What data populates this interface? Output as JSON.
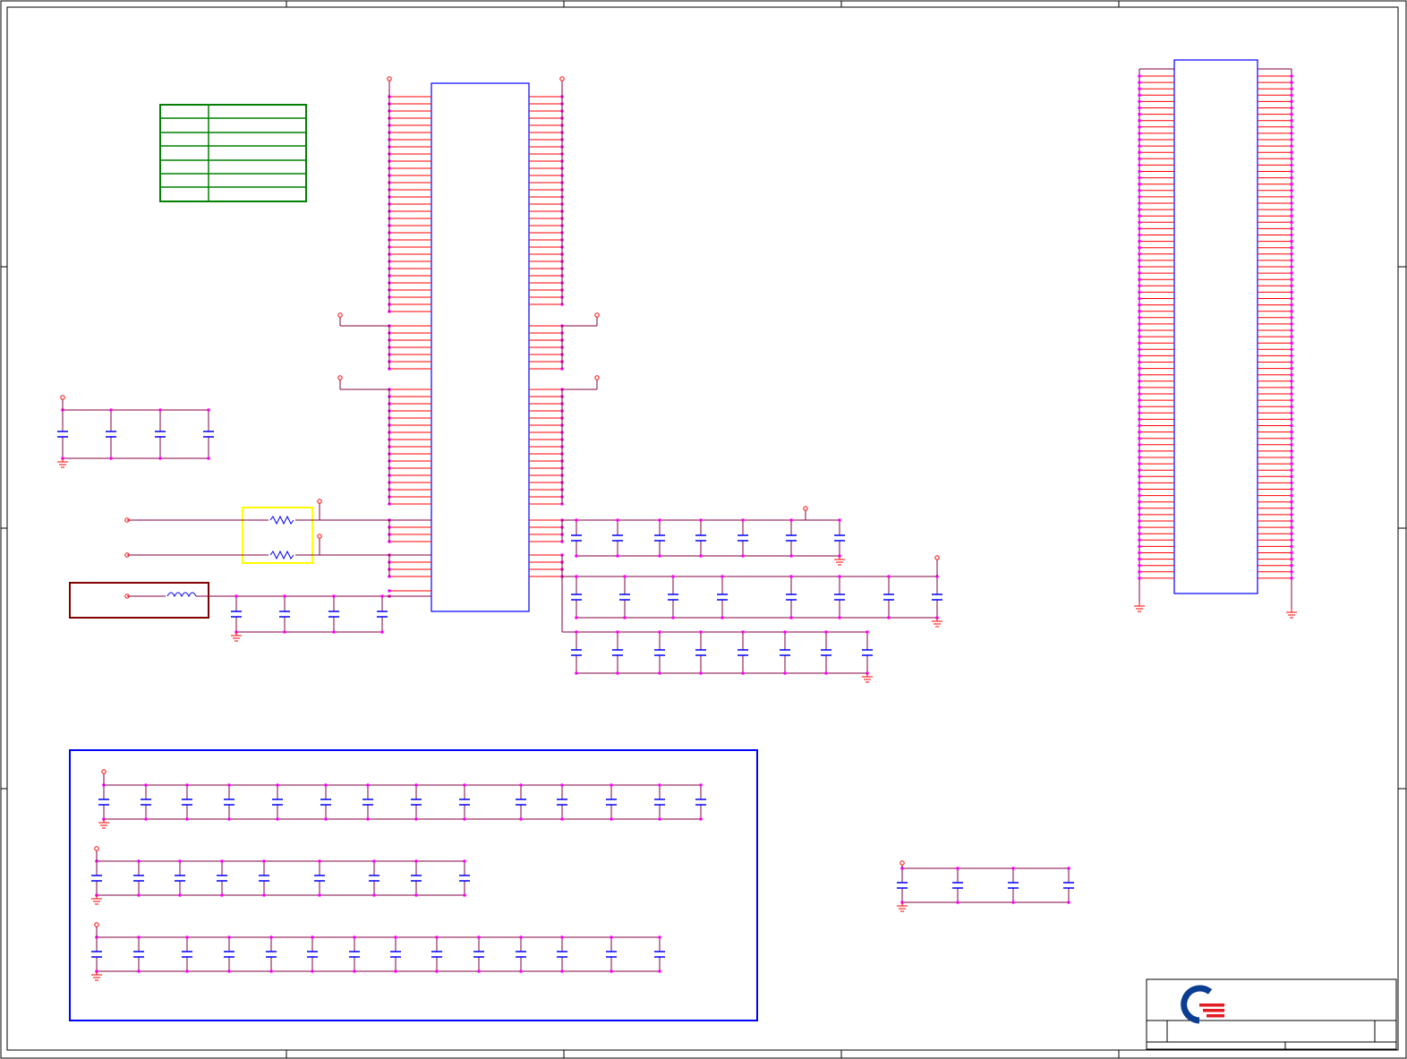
{
  "colors": {
    "frame": "#000000",
    "wire": "#800040",
    "pin": "#ff0000",
    "junction": "#ff00ff",
    "component": "#0000ff",
    "table_border": "#008000",
    "highlight_box": "#ffff00",
    "inductor_box": "#800000",
    "decap_box": "#0000ff",
    "logo_blue": "#0b3d91",
    "logo_red": "#e31b23"
  },
  "sheet": {
    "zones": 5,
    "rows": 4
  },
  "components": {
    "main_ic": {
      "left_pins": 80,
      "right_pins": 72
    },
    "connector": {
      "pins_per_side": 80
    },
    "decoupling_groups": [
      {
        "id": "top-left",
        "count": 4
      },
      {
        "id": "mid-left",
        "count": 4
      },
      {
        "id": "right-row-1",
        "count": 6
      },
      {
        "id": "right-row-2",
        "count": 8
      },
      {
        "id": "right-row-3",
        "count": 8
      },
      {
        "id": "bank-row-1",
        "count": 14
      },
      {
        "id": "bank-row-2",
        "count": 9
      },
      {
        "id": "bank-row-3",
        "count": 14
      },
      {
        "id": "lower-right",
        "count": 4
      }
    ],
    "resistors": 2,
    "inductors": 1
  },
  "icons": {
    "logo": "company-logo-icon",
    "ground": "ground-symbol-icon",
    "power": "power-port-icon"
  }
}
